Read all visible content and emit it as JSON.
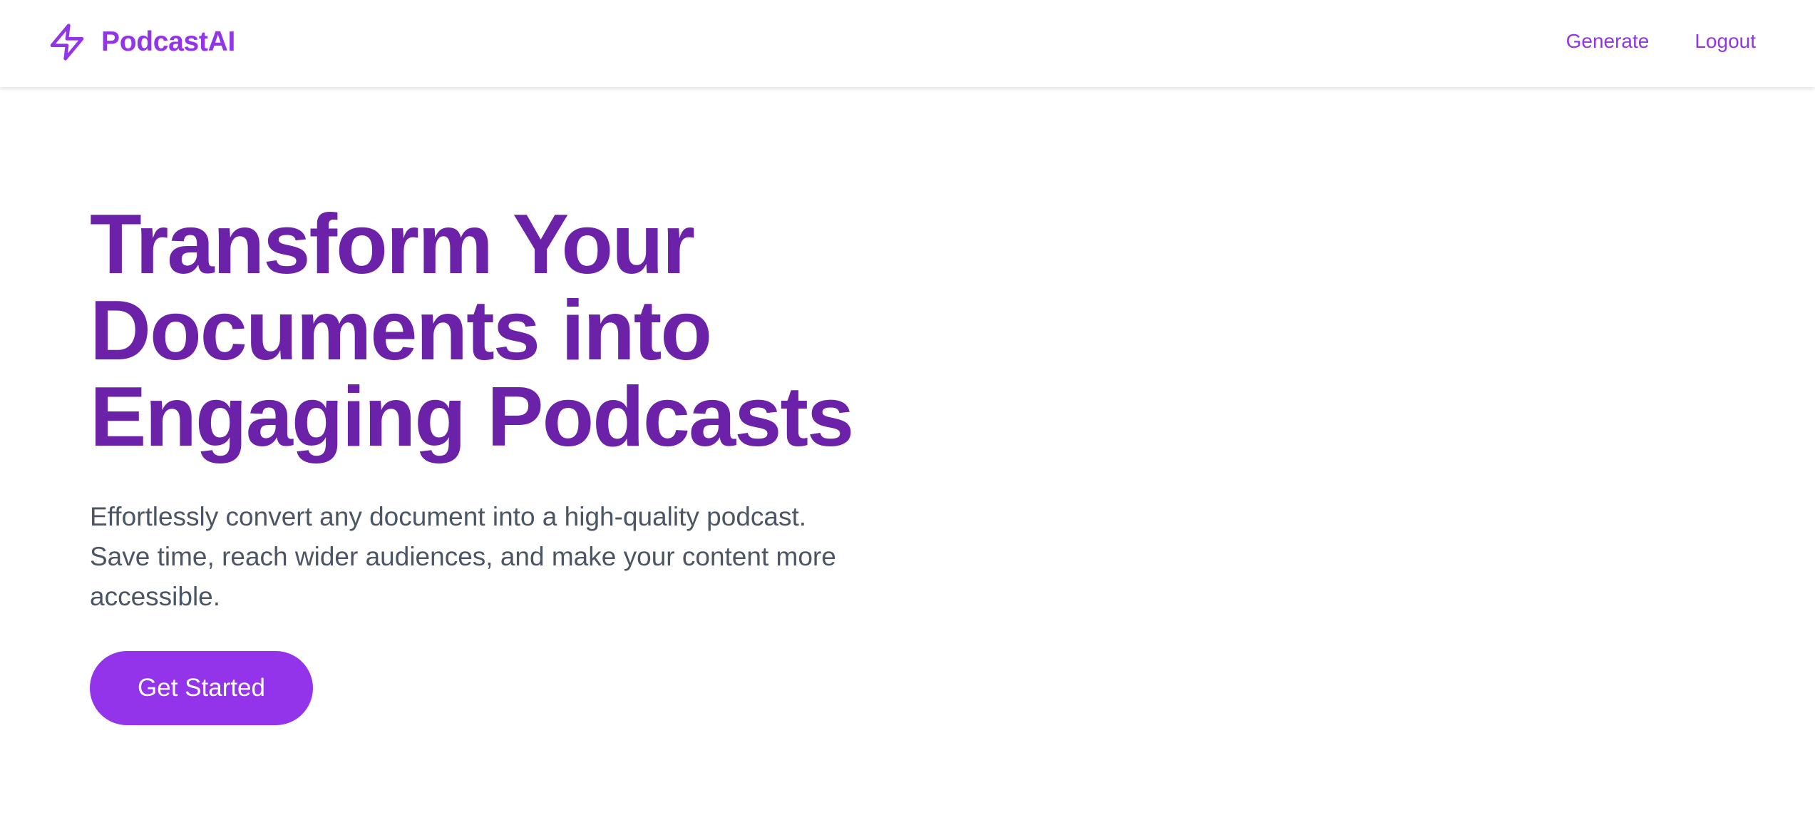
{
  "colors": {
    "brand": "#9333ea",
    "heading": "#6b21a8",
    "body_text": "#4b5563",
    "button_bg": "#9333ea",
    "button_text": "#ffffff"
  },
  "header": {
    "brand_name": "PodcastAI",
    "brand_icon": "lightning-bolt-icon",
    "nav": [
      {
        "label": "Generate"
      },
      {
        "label": "Logout"
      }
    ]
  },
  "hero": {
    "title_lines": [
      "Transform Your",
      "Documents into",
      "Engaging Podcasts"
    ],
    "subtitle_lines": [
      "Effortlessly convert any document into a high-quality podcast.",
      "Save time, reach wider audiences, and make your content more",
      "accessible."
    ],
    "cta_label": "Get Started"
  }
}
